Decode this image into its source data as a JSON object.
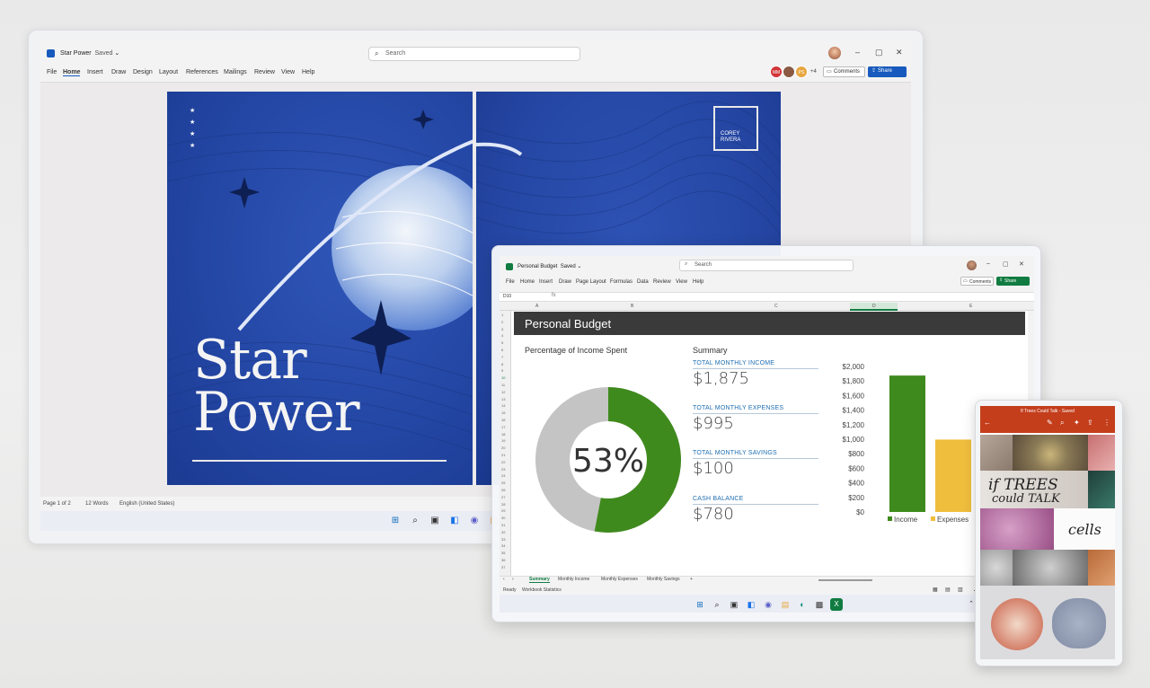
{
  "word": {
    "doc_name": "Star Power",
    "saved": "Saved",
    "search_placeholder": "Search",
    "menu": [
      "File",
      "Home",
      "Insert",
      "Draw",
      "Design",
      "Layout",
      "References",
      "Mailings",
      "Review",
      "View",
      "Help"
    ],
    "coauthors": [
      {
        "initials": "MM",
        "color": "#d13438"
      },
      {
        "initials": "",
        "color": "#8a5a44"
      },
      {
        "initials": "PS",
        "color": "#e8a640"
      }
    ],
    "coauthor_more": "+4",
    "comments_label": "Comments",
    "share_label": "Share",
    "cover_title_line1": "Star",
    "cover_title_line2": "Power",
    "author_line1": "COREY",
    "author_line2": "RIVERA",
    "status": {
      "page": "Page 1 of 2",
      "words": "12 Words",
      "language": "English (United States)"
    },
    "accent": "#185abd"
  },
  "excel": {
    "doc_name": "Personal Budget",
    "saved": "Saved",
    "search_placeholder": "Search",
    "menu": [
      "File",
      "Home",
      "Insert",
      "Draw",
      "Page Layout",
      "Formulas",
      "Data",
      "Review",
      "View",
      "Help"
    ],
    "comments_label": "Comments",
    "share_label": "Share",
    "name_box": "D10",
    "fx": "fx",
    "columns": [
      "A",
      "B",
      "C",
      "D",
      "E"
    ],
    "banner_title": "Personal Budget",
    "donut_title": "Percentage of Income Spent",
    "donut_percent": "53%",
    "donut_fraction": 0.53,
    "summary_title": "Summary",
    "summary": [
      {
        "label": "TOTAL MONTHLY INCOME",
        "value": "$1,875"
      },
      {
        "label": "TOTAL MONTHLY EXPENSES",
        "value": "$995"
      },
      {
        "label": "TOTAL MONTHLY SAVINGS",
        "value": "$100"
      },
      {
        "label": "CASH BALANCE",
        "value": "$780"
      }
    ],
    "sheet_tabs": [
      "Summary",
      "Monthly Income",
      "Monthly Expenses",
      "Monthly Savings"
    ],
    "status_ready": "Ready",
    "status_stats": "Workbook Statistics",
    "accent": "#107c41"
  },
  "chart_data": {
    "type": "bar",
    "categories": [
      "Income",
      "Expenses"
    ],
    "values": [
      1875,
      995
    ],
    "colors": [
      "#3f8a1d",
      "#f0be3d"
    ],
    "yticks": [
      "$0",
      "$200",
      "$400",
      "$600",
      "$800",
      "$1,000",
      "$1,200",
      "$1,400",
      "$1,600",
      "$1,800",
      "$2,000"
    ],
    "ylim": [
      0,
      2000
    ],
    "legend": [
      "Income",
      "Expenses"
    ],
    "legend_position": "bottom",
    "title": "",
    "xlabel": "",
    "ylabel": ""
  },
  "phone": {
    "doc_title": "If Trees Could Talk - Saved",
    "cover_line1": "if TREES",
    "cover_line2": "could TALK",
    "cells_label": "cells",
    "accent": "#c43e1c"
  }
}
